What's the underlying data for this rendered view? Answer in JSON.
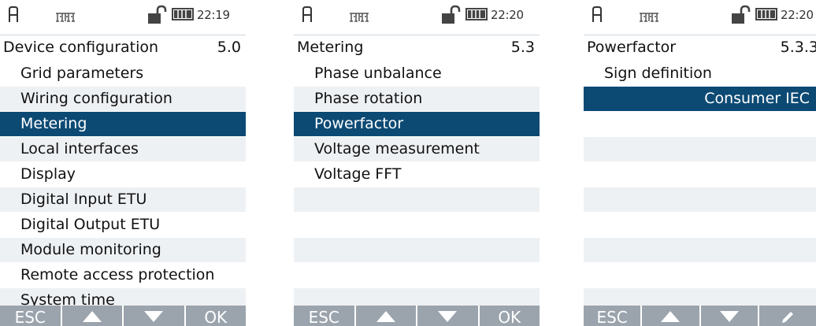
{
  "screens": [
    {
      "status": {
        "time": "22:19"
      },
      "title": "Device configuration",
      "section": "5.0",
      "items": [
        "Grid parameters",
        "Wiring configuration",
        "Metering",
        "Local interfaces",
        "Display",
        "Digital Input ETU",
        "Digital Output ETU",
        "Module monitoring",
        "Remote access protection",
        "System time"
      ],
      "selected": "Metering",
      "softkeys": [
        "ESC",
        "up-arrow-icon",
        "down-arrow-icon",
        "OK"
      ]
    },
    {
      "status": {
        "time": "22:20"
      },
      "title": "Metering",
      "section": "5.3",
      "items": [
        "Phase unbalance",
        "Phase rotation",
        "Powerfactor",
        "Voltage measurement",
        "Voltage FFT"
      ],
      "selected": "Powerfactor",
      "softkeys": [
        "ESC",
        "up-arrow-icon",
        "down-arrow-icon",
        "OK"
      ]
    },
    {
      "status": {
        "time": "22:20"
      },
      "title": "Powerfactor",
      "section": "5.3.3",
      "items": [
        "Sign definition"
      ],
      "value": "Consumer IEC",
      "softkeys": [
        "ESC",
        "up-arrow-icon",
        "down-arrow-icon",
        "pencil-icon"
      ]
    }
  ],
  "colors": {
    "selection": "#0c4a74",
    "stripe": "#eef1f4",
    "softkey_bar": "#9ba4ad"
  }
}
